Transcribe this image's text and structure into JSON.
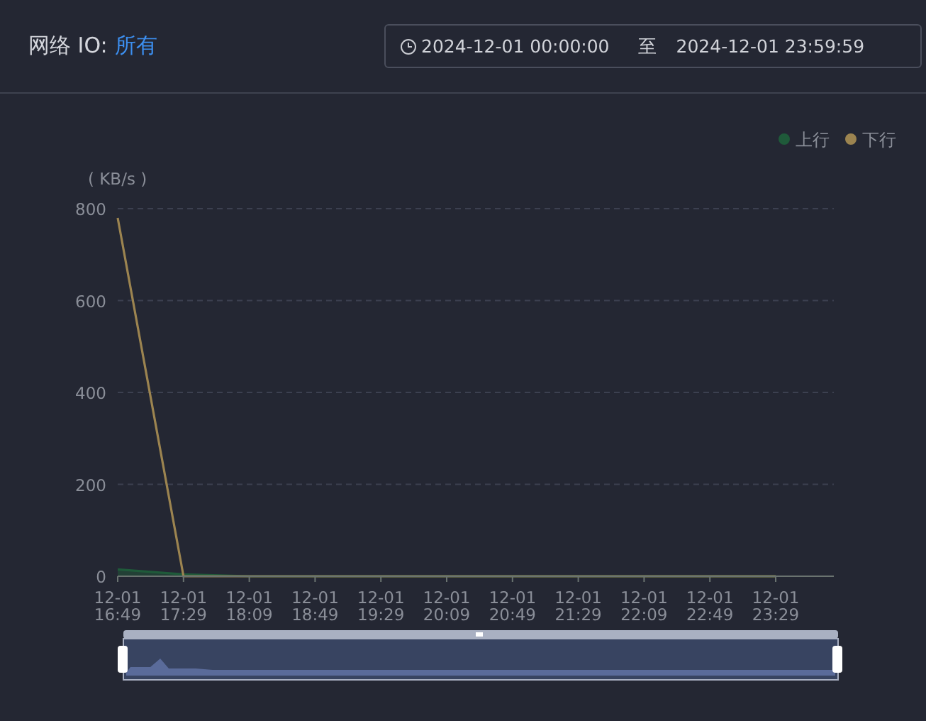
{
  "header": {
    "title": "网络 IO:",
    "filter_link": "所有",
    "date_range": {
      "start": "2024-12-01 00:00:00",
      "separator": "至",
      "end": "2024-12-01 23:59:59"
    }
  },
  "chart": {
    "chart_data": {
      "type": "line",
      "ylabel": "( KB/s )",
      "categories": [
        "12-01 16:49",
        "12-01 17:29",
        "12-01 18:09",
        "12-01 18:49",
        "12-01 19:29",
        "12-01 20:09",
        "12-01 20:49",
        "12-01 21:29",
        "12-01 22:09",
        "12-01 22:49",
        "12-01 23:29"
      ],
      "series": [
        {
          "name": "上行",
          "color": "#1f5a3a",
          "values": [
            15,
            4,
            0,
            0,
            0,
            0,
            0,
            0,
            0,
            0,
            0
          ]
        },
        {
          "name": "下行",
          "color": "#9c8450",
          "values": [
            780,
            0,
            0,
            0,
            0,
            0,
            0,
            0,
            0,
            0,
            0
          ]
        }
      ],
      "ylim": [
        0,
        800
      ],
      "yticks": [
        0,
        200,
        400,
        600,
        800
      ],
      "grid": true,
      "legend": true
    }
  }
}
